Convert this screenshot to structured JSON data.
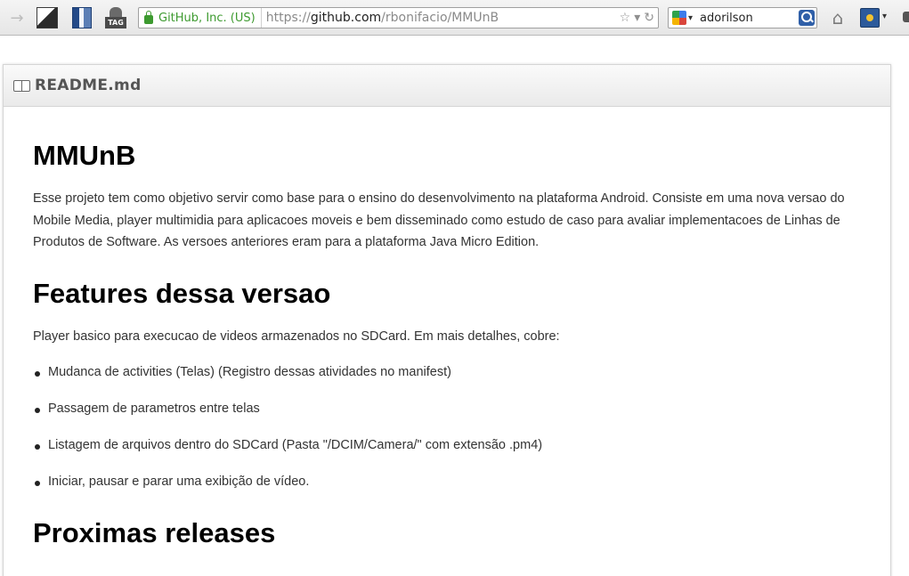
{
  "browser": {
    "url": {
      "identity": "GitHub, Inc. (US)",
      "scheme": "https://",
      "host": "github.com",
      "path": "/rbonifacio/MMUnB"
    },
    "search": {
      "value": "adorilson",
      "engine_icon": "google-icon"
    },
    "icons": {
      "forward": "→",
      "star": "☆",
      "dropdown": "▾",
      "reload": "↻",
      "home": "⌂",
      "tag": "TAG"
    }
  },
  "readme": {
    "filename": "README.md",
    "h1": "MMUnB",
    "intro": "Esse projeto tem como objetivo servir como base para o ensino do desenvolvimento na plataforma Android. Consiste em uma nova versao do Mobile Media, player multimidia para aplicacoes moveis e bem disseminado como estudo de caso para avaliar implementacoes de Linhas de Produtos de Software. As versoes anteriores eram para a plataforma Java Micro Edition.",
    "h2_features": "Features dessa versao",
    "features_intro": "Player basico para execucao de videos armazenados no SDCard. Em mais detalhes, cobre:",
    "features": [
      "Mudanca de activities (Telas) (Registro dessas atividades no manifest)",
      "Passagem de parametros entre telas",
      "Listagem de arquivos dentro do SDCard (Pasta \"/DCIM/Camera/\" com extensão .pm4)",
      "Iniciar, pausar e parar uma exibição de vídeo."
    ],
    "h2_next": "Proximas releases"
  }
}
